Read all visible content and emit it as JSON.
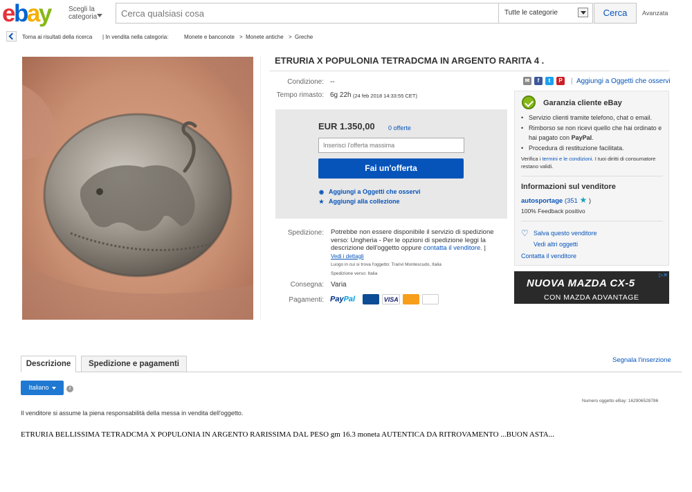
{
  "header": {
    "logo": {
      "e": "e",
      "b": "b",
      "a": "a",
      "y": "y"
    },
    "shop_by_category": "Scegli la categoria",
    "search_placeholder": "Cerca qualsiasi cosa",
    "category_select": "Tutte le categorie",
    "search_button": "Cerca",
    "advanced": "Avanzata"
  },
  "breadcrumb": {
    "back": "Torna ai risultati della ricerca",
    "sep": "| In vendita nella categoria:",
    "crumbs": [
      "Monete e banconote",
      "Monete antiche",
      "Greche"
    ],
    "arrow": ">"
  },
  "item": {
    "title": "ETRURIA X POPULONIA TETRADCMA IN ARGENTO RARITA 4 .",
    "condition_label": "Condizione:",
    "condition_value": "--",
    "time_label": "Tempo rimasto:",
    "time_value": "6g 22h",
    "time_detail": "(24 feb 2018   14:33:55 CET)",
    "price": "EUR 1.350,00",
    "offers": "0 offerte",
    "bid_placeholder": "Inserisci l'offerta massima",
    "bid_button": "Fai un'offerta",
    "watch": "Aggiungi a Oggetti che osservi",
    "collection": "Aggiungi alla collezione",
    "shipping_label": "Spedizione:",
    "shipping_text_1": "Potrebbe non essere disponibile il servizio di spedizione verso: Ungheria - Per le opzioni di spedizione leggi la descrizione dell'oggetto oppure",
    "shipping_contact": "contatta il venditore.",
    "shipping_bar": "|",
    "shipping_details": "Vedi i dettagli",
    "location": "Luogo in cui si trova l'oggetto:  Trarivi Montescudo, Italia",
    "ships_to": "Spedizione verso:  Italia",
    "delivery_label": "Consegna:",
    "delivery_value": "Varia",
    "payments_label": "Pagamenti:",
    "paypal_a": "Pay",
    "paypal_b": "Pal"
  },
  "right": {
    "share_icons": [
      "email-icon",
      "facebook-icon",
      "twitter-icon",
      "pinterest-icon"
    ],
    "share_glyphs": [
      "✉",
      "f",
      "t",
      "P"
    ],
    "share_colors": [
      "#8a8a8a",
      "#3b5998",
      "#1da1f2",
      "#cb2027"
    ],
    "watch_bar": "|",
    "watch": "Aggiungi a Oggetti che osservi",
    "guarantee_title": "Garanzia cliente eBay",
    "guarantee_items": [
      "Servizio clienti tramite telefono, chat o email.",
      "Rimborso se non ricevi quello che hai ordinato e hai pagato con",
      "Procedura di restituzione facilitata."
    ],
    "paypal_bold": "PayPal",
    "fine_a": "Verifica i",
    "fine_link": "termini e le condizioni",
    "fine_b": ". I tuoi diritti di consumatore restano validi.",
    "seller_title": "Informazioni sul venditore",
    "seller_name": "autosportage",
    "seller_score": "(351",
    "seller_close": ")",
    "feedback": "100% Feedback positivo",
    "save_seller": "Salva questo venditore",
    "other_items": "Vedi altri oggetti",
    "contact": "Contatta il venditore"
  },
  "ad": {
    "line1": "NUOVA MAZDA CX-5",
    "line2": "CON MAZDA ADVANTAGE"
  },
  "tabs": {
    "description": "Descrizione",
    "shipping": "Spedizione e pagamenti",
    "report": "Segnala l'inserzione"
  },
  "desc": {
    "language": "Italiano",
    "item_number": "Numero oggetto eBay:   162906528786",
    "responsibility": "Il venditore si assume la piena responsabilità della messa in vendita dell'oggetto.",
    "text": "ETRURIA BELLISSIMA TETRADCMA X POPULONIA IN ARGENTO RARISSIMA DAL PESO gm 16.3 moneta AUTENTICA DA RITROVAMENTO ...BUON ASTA..."
  },
  "colors": {
    "brand_blue": "#0654ba",
    "bid_button": "#0654ba",
    "guarantee_green": "#86b817"
  }
}
